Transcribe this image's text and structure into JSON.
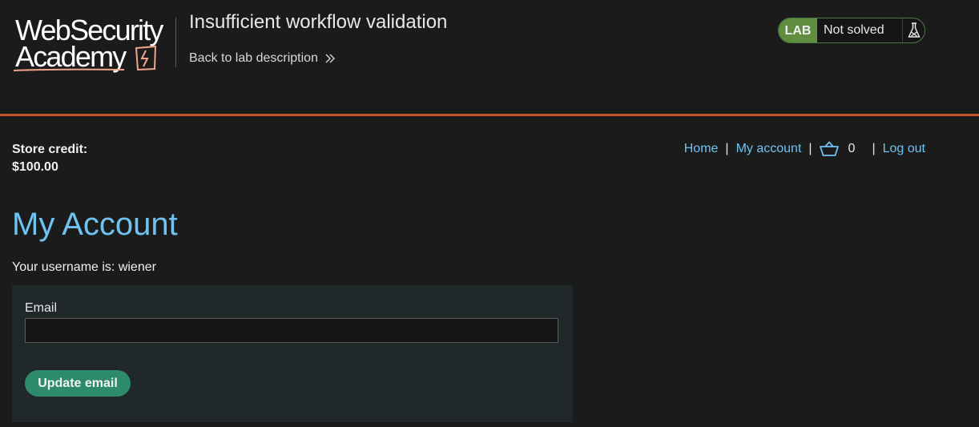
{
  "header": {
    "logo_line1": "WebSecurity",
    "logo_line2": "Academy",
    "lab_title": "Insufficient workflow validation",
    "back_link": "Back to lab description",
    "status_badge": "LAB",
    "status_text": "Not solved"
  },
  "store": {
    "credit_label": "Store credit:",
    "credit_value": "$100.00"
  },
  "nav": {
    "home": "Home",
    "my_account": "My account",
    "separator": "|",
    "cart_count": "0",
    "log_out": "Log out"
  },
  "main": {
    "title": "My Account",
    "username_text": "Your username is: wiener"
  },
  "form": {
    "email_label": "Email",
    "email_value": "",
    "update_button": "Update email"
  },
  "colors": {
    "background": "#1b1b1b",
    "accent_link": "#6ec3f0",
    "divider_orange": "#c0542a",
    "lab_badge": "#5f8f3e",
    "button": "#2e8a6c",
    "panel": "#21282a"
  },
  "icons": {
    "logo_mark": "lightning-bolt-icon",
    "back": "double-chevron-right-icon",
    "status": "flask-icon",
    "cart": "basket-icon"
  }
}
